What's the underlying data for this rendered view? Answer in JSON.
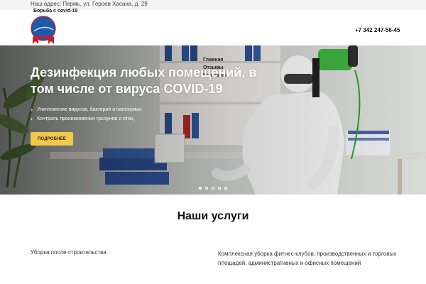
{
  "topbar": {
    "address": "Наш адрес: Пермь, ул. Героев Хасана, д. 29"
  },
  "header": {
    "brand_title": "Борьба с covid-19",
    "phone": "+7 342 247-56-45"
  },
  "nav": {
    "items": [
      {
        "label": "Главная"
      },
      {
        "label": "Отзывы"
      },
      {
        "label": "Контакты"
      }
    ]
  },
  "hero": {
    "title": "Дезинфекция любых помещений, в том числе от вируса COVID-19",
    "bullets": [
      "Уничтожение вирусов, бактерий и насекомых",
      "Контроль проникновения грызунов и птиц"
    ],
    "cta_label": "ПОДРОБНЕЕ",
    "slides_total": 5,
    "slide_active": 1
  },
  "services": {
    "title": "Наши услуги",
    "items": [
      {
        "label": "Уборка после строительства"
      },
      {
        "label": "Комплексная уборка фитнес-клубов, производственных и торговых площадей, административных и офисных помещений"
      }
    ]
  },
  "colors": {
    "accent": "#f2c84b",
    "logo_blue": "#1f5aa8",
    "logo_red": "#c81e2a",
    "topbar_bg": "#f3f3f3"
  }
}
